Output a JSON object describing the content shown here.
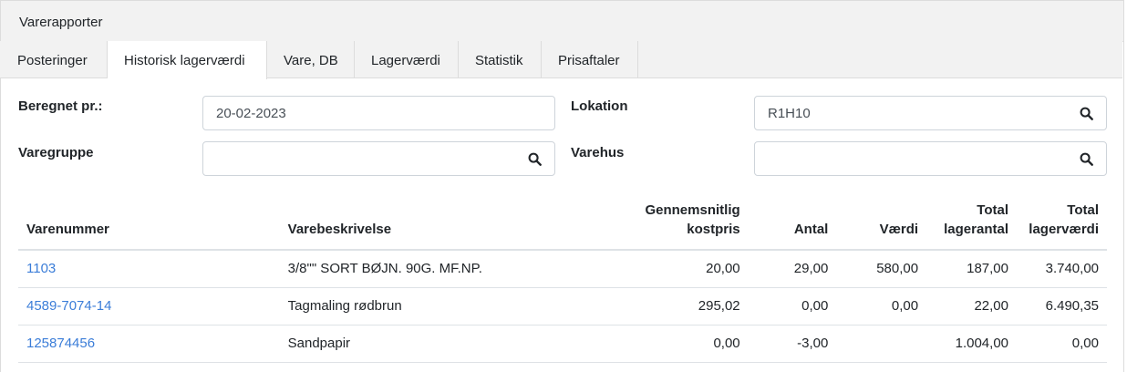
{
  "header": {
    "title": "Varerapporter"
  },
  "tabs": [
    {
      "label": "Posteringer"
    },
    {
      "label": "Historisk lagerværdi"
    },
    {
      "label": "Vare, DB"
    },
    {
      "label": "Lagerværdi"
    },
    {
      "label": "Statistik"
    },
    {
      "label": "Prisaftaler"
    }
  ],
  "active_tab": "Historisk lagerværdi",
  "filters": {
    "beregnet_label": "Beregnet pr.:",
    "beregnet_value": "20-02-2023",
    "lokation_label": "Lokation",
    "lokation_value": "R1H10",
    "varegruppe_label": "Varegruppe",
    "varegruppe_value": "",
    "varehus_label": "Varehus",
    "varehus_value": ""
  },
  "icons": {
    "search": "search-icon"
  },
  "colors": {
    "link": "#3b7dd8",
    "tab_bar": "#f2f2f2"
  },
  "table": {
    "headers": {
      "varenummer": "Varenummer",
      "varebeskrivelse": "Varebeskrivelse",
      "kostpris_line1": "Gennemsnitlig",
      "kostpris_line2": "kostpris",
      "antal": "Antal",
      "vaerdi": "Værdi",
      "lagerantal_line1": "Total",
      "lagerantal_line2": "lagerantal",
      "lagervaerdi_line1": "Total",
      "lagervaerdi_line2": "lagerværdi"
    },
    "rows": [
      {
        "varenummer": "1103",
        "varebeskrivelse": "3/8\"\" SORT BØJN. 90G. MF.NP.",
        "kostpris": "20,00",
        "antal": "29,00",
        "vaerdi": "580,00",
        "lagerantal": "187,00",
        "lagervaerdi": "3.740,00"
      },
      {
        "varenummer": "4589-7074-14",
        "varebeskrivelse": "Tagmaling rødbrun",
        "kostpris": "295,02",
        "antal": "0,00",
        "vaerdi": "0,00",
        "lagerantal": "22,00",
        "lagervaerdi": "6.490,35"
      },
      {
        "varenummer": "125874456",
        "varebeskrivelse": "Sandpapir",
        "kostpris": "0,00",
        "antal": "-3,00",
        "vaerdi": "",
        "lagerantal": "1.004,00",
        "lagervaerdi": "0,00"
      }
    ]
  }
}
